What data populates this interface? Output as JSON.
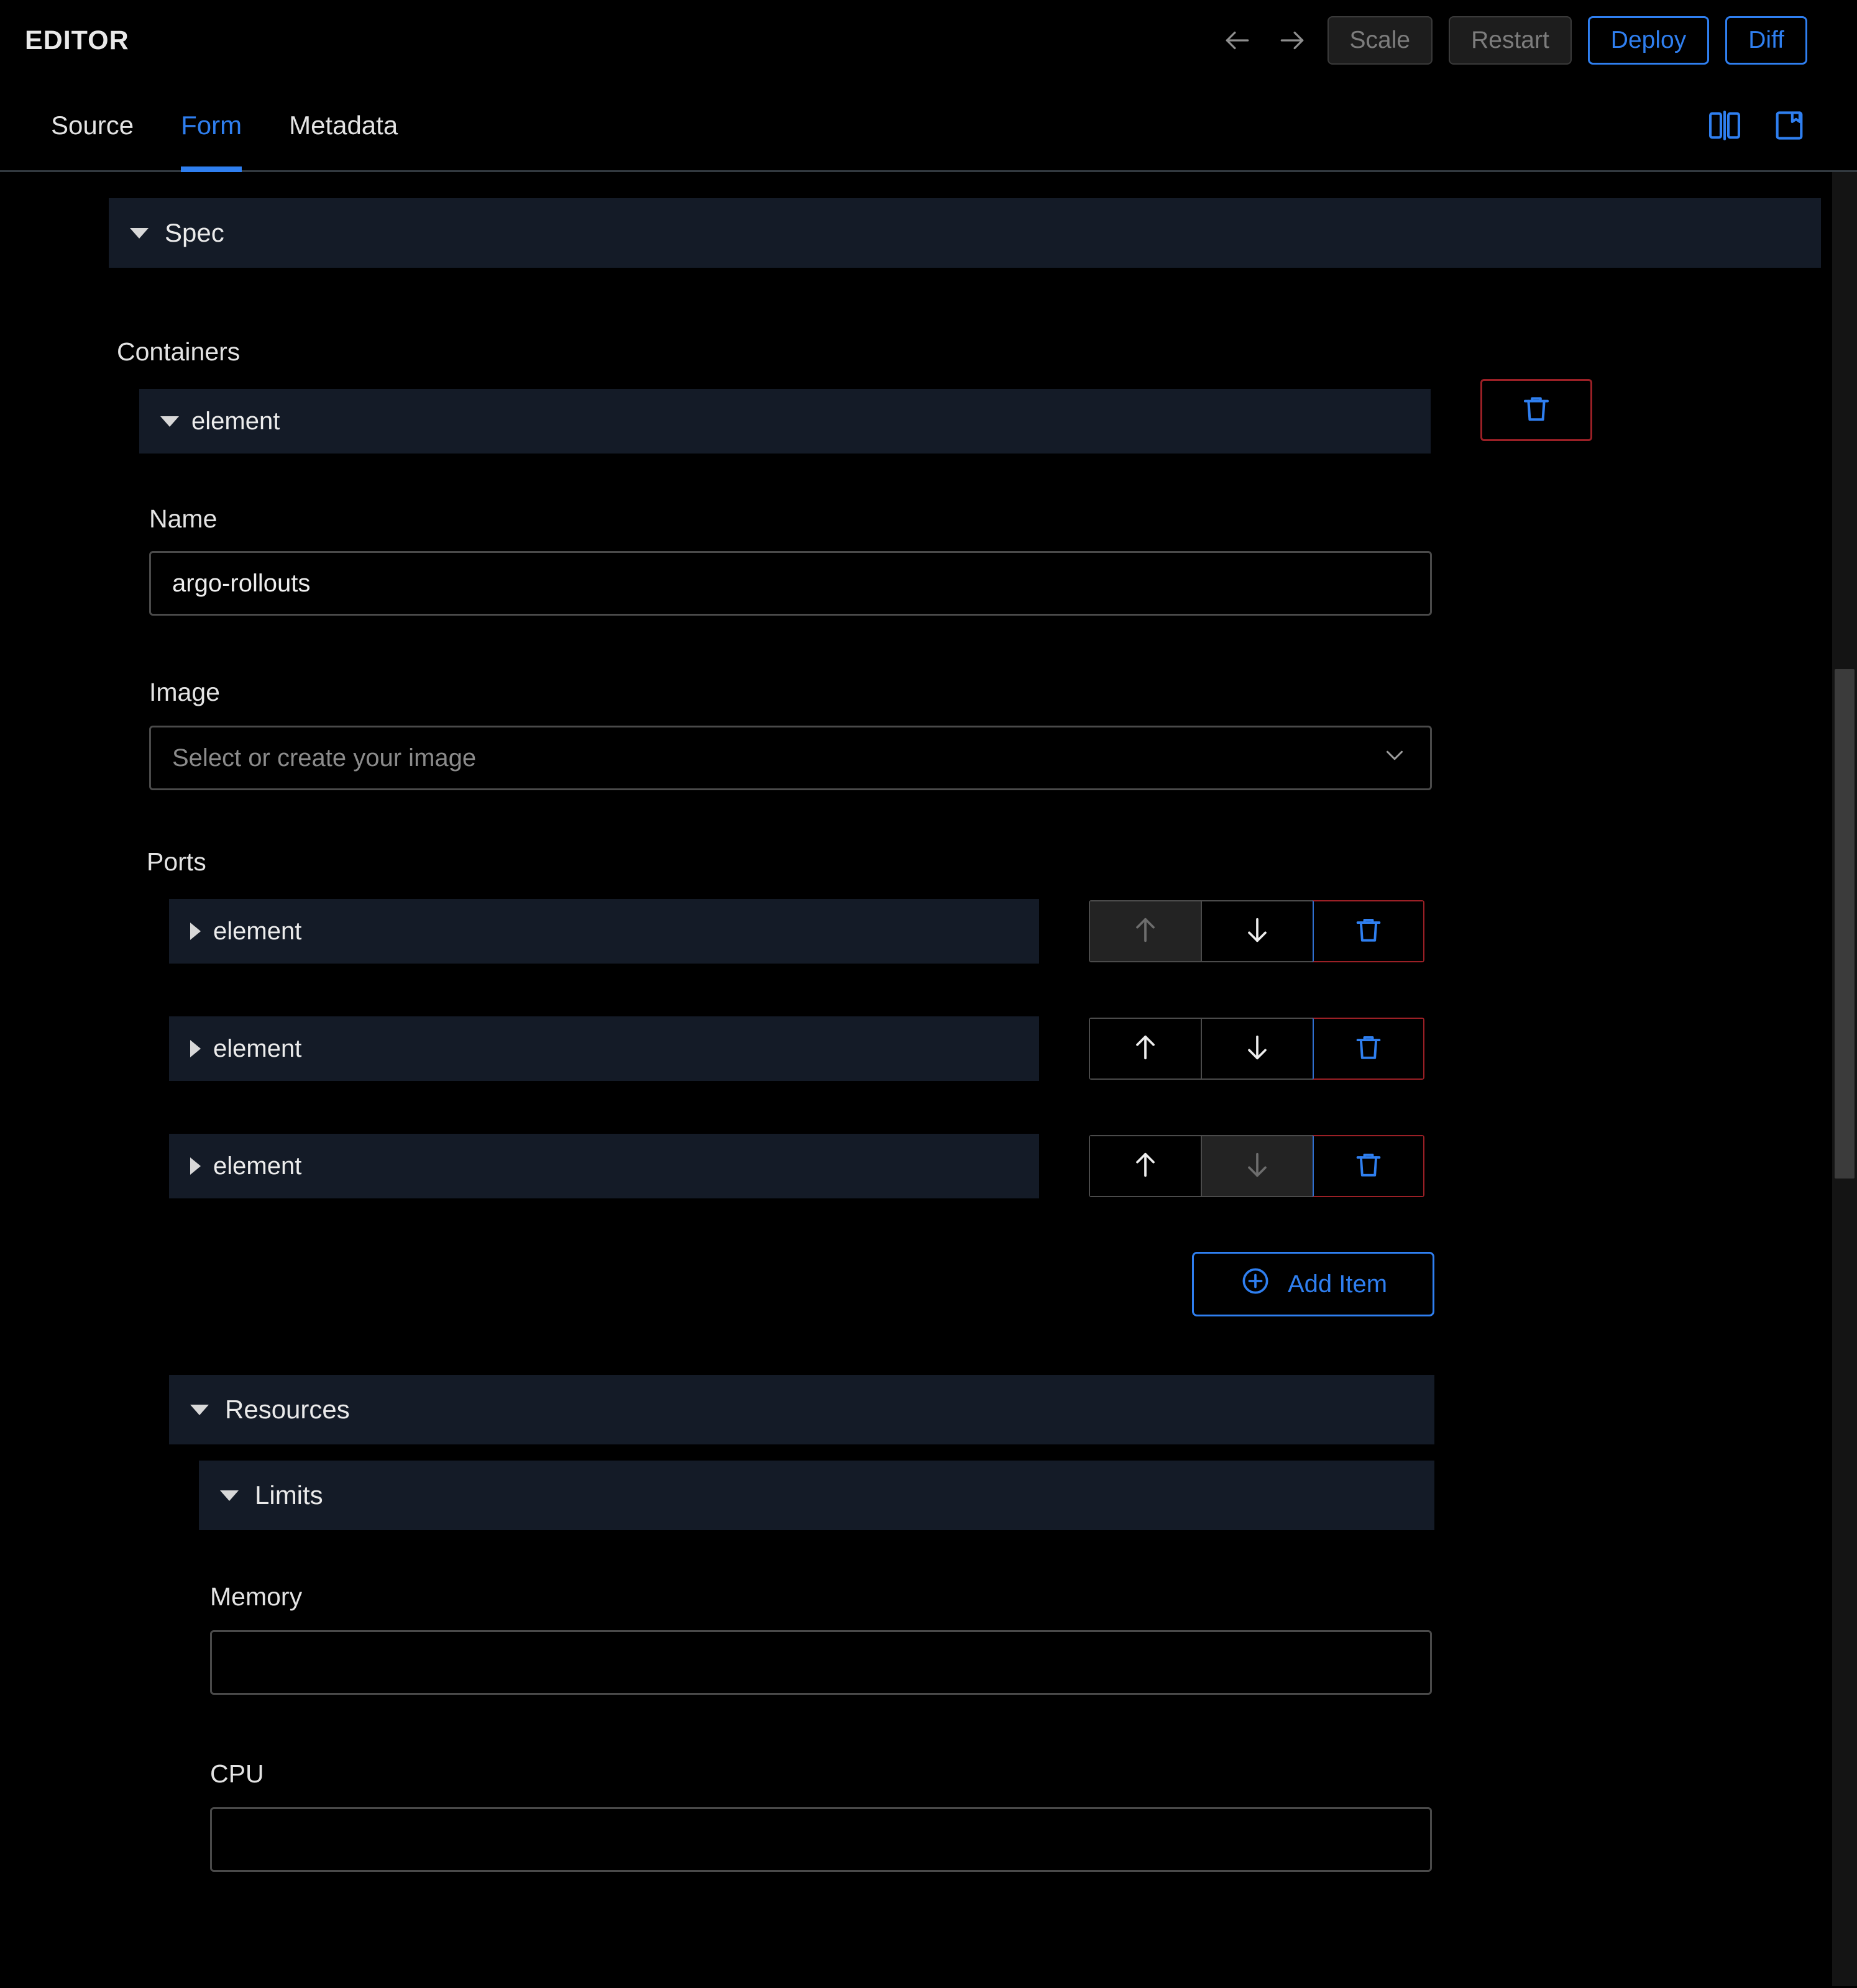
{
  "header": {
    "title": "EDITOR",
    "back_icon": "arrow-left-icon",
    "forward_icon": "arrow-right-icon",
    "buttons": [
      {
        "label": "Scale",
        "style": "muted"
      },
      {
        "label": "Restart",
        "style": "muted"
      },
      {
        "label": "Deploy",
        "style": "primary"
      },
      {
        "label": "Diff",
        "style": "primary"
      }
    ]
  },
  "tabbar": {
    "tabs": [
      {
        "label": "Source",
        "active": false
      },
      {
        "label": "Form",
        "active": true
      },
      {
        "label": "Metadata",
        "active": false
      }
    ],
    "layout_icons": [
      {
        "name": "split-view-icon"
      },
      {
        "name": "single-panel-icon"
      }
    ]
  },
  "form": {
    "spec": {
      "title": "Spec",
      "expanded": true
    },
    "containers": {
      "label": "Containers",
      "item_label": "element",
      "delete_icon": "trash-icon"
    },
    "name": {
      "label": "Name",
      "value": "argo-rollouts"
    },
    "image": {
      "label": "Image",
      "value": "",
      "placeholder": "Select or create your image",
      "chevron_icon": "chevron-down-icon"
    },
    "ports": {
      "label": "Ports",
      "items": [
        {
          "label": "element",
          "up_enabled": false,
          "down_enabled": true
        },
        {
          "label": "element",
          "up_enabled": true,
          "down_enabled": true
        },
        {
          "label": "element",
          "up_enabled": true,
          "down_enabled": false
        }
      ],
      "move_up_icon": "arrow-up-icon",
      "move_down_icon": "arrow-down-icon",
      "delete_icon": "trash-icon",
      "add_item": {
        "label": "Add Item",
        "icon": "plus-circle-icon"
      }
    },
    "resources": {
      "title": "Resources",
      "expanded": true
    },
    "limits": {
      "title": "Limits",
      "expanded": true
    },
    "memory": {
      "label": "Memory",
      "value": "",
      "placeholder": ""
    },
    "cpu": {
      "label": "CPU",
      "value": "",
      "placeholder": ""
    }
  },
  "colors": {
    "accent_blue": "#2f7ff0",
    "danger_red": "#9b2026",
    "panel_navy": "#141b27",
    "background": "#000000"
  }
}
